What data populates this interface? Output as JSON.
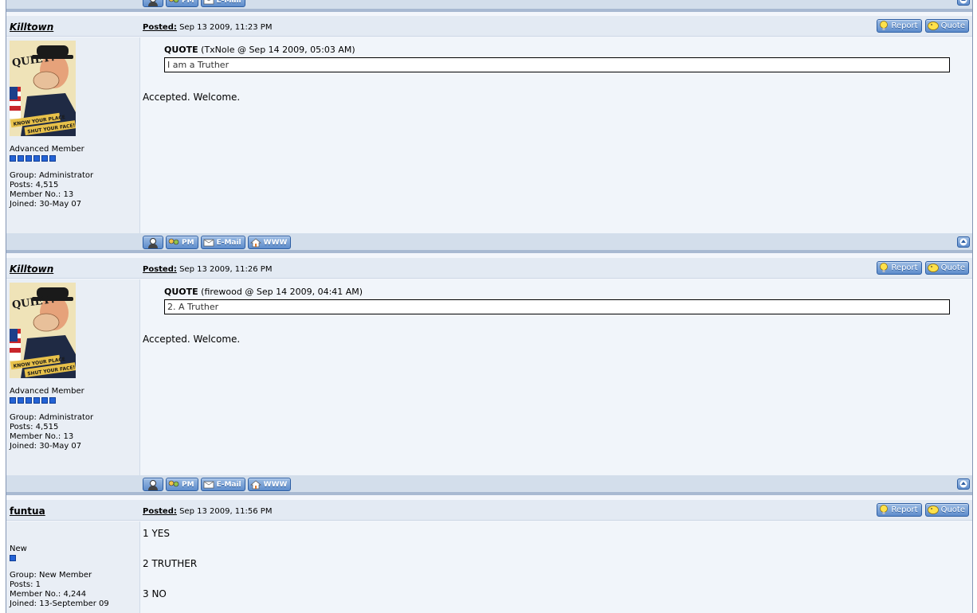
{
  "buttons": {
    "profile_icon": "profile-icon",
    "pm": "PM",
    "email": "E-Mail",
    "www": "WWW",
    "report": "Report",
    "quote": "Quote"
  },
  "posts": [
    {
      "username": "Killtown",
      "posted_label": "Posted:",
      "posted_date": "Sep 13 2009, 11:23 PM",
      "rank": "Advanced Member",
      "pips": 6,
      "group": "Group: Administrator",
      "posts": "Posts: 4,515",
      "member_no": "Member No.: 13",
      "joined": "Joined: 30-May 07",
      "quote_label": "QUOTE",
      "quote_source": "(TxNole @ Sep 14 2009, 05:03 AM)",
      "quote_text": "I am a Truther",
      "text": "Accepted. Welcome."
    },
    {
      "username": "Killtown",
      "posted_label": "Posted:",
      "posted_date": "Sep 13 2009, 11:26 PM",
      "rank": "Advanced Member",
      "pips": 6,
      "group": "Group: Administrator",
      "posts": "Posts: 4,515",
      "member_no": "Member No.: 13",
      "joined": "Joined: 30-May 07",
      "quote_label": "QUOTE",
      "quote_source": "(firewood @ Sep 14 2009, 04:41 AM)",
      "quote_text": "2. A Truther",
      "text": "Accepted. Welcome."
    },
    {
      "username": "funtua",
      "posted_label": "Posted:",
      "posted_date": "Sep 13 2009, 11:56 PM",
      "rank": "New",
      "pips": 1,
      "group": "Group: New Member",
      "posts": "Posts: 1",
      "member_no": "Member No.: 4,244",
      "joined": "Joined: 13-September 09",
      "lines": [
        "1 YES",
        "2 TRUTHER",
        "3 NO"
      ]
    }
  ],
  "avatar": {
    "title": "QUIET!",
    "slogan_1": "KNOW YOUR PLACE",
    "slogan_2": "SHUT YOUR FACE!"
  }
}
